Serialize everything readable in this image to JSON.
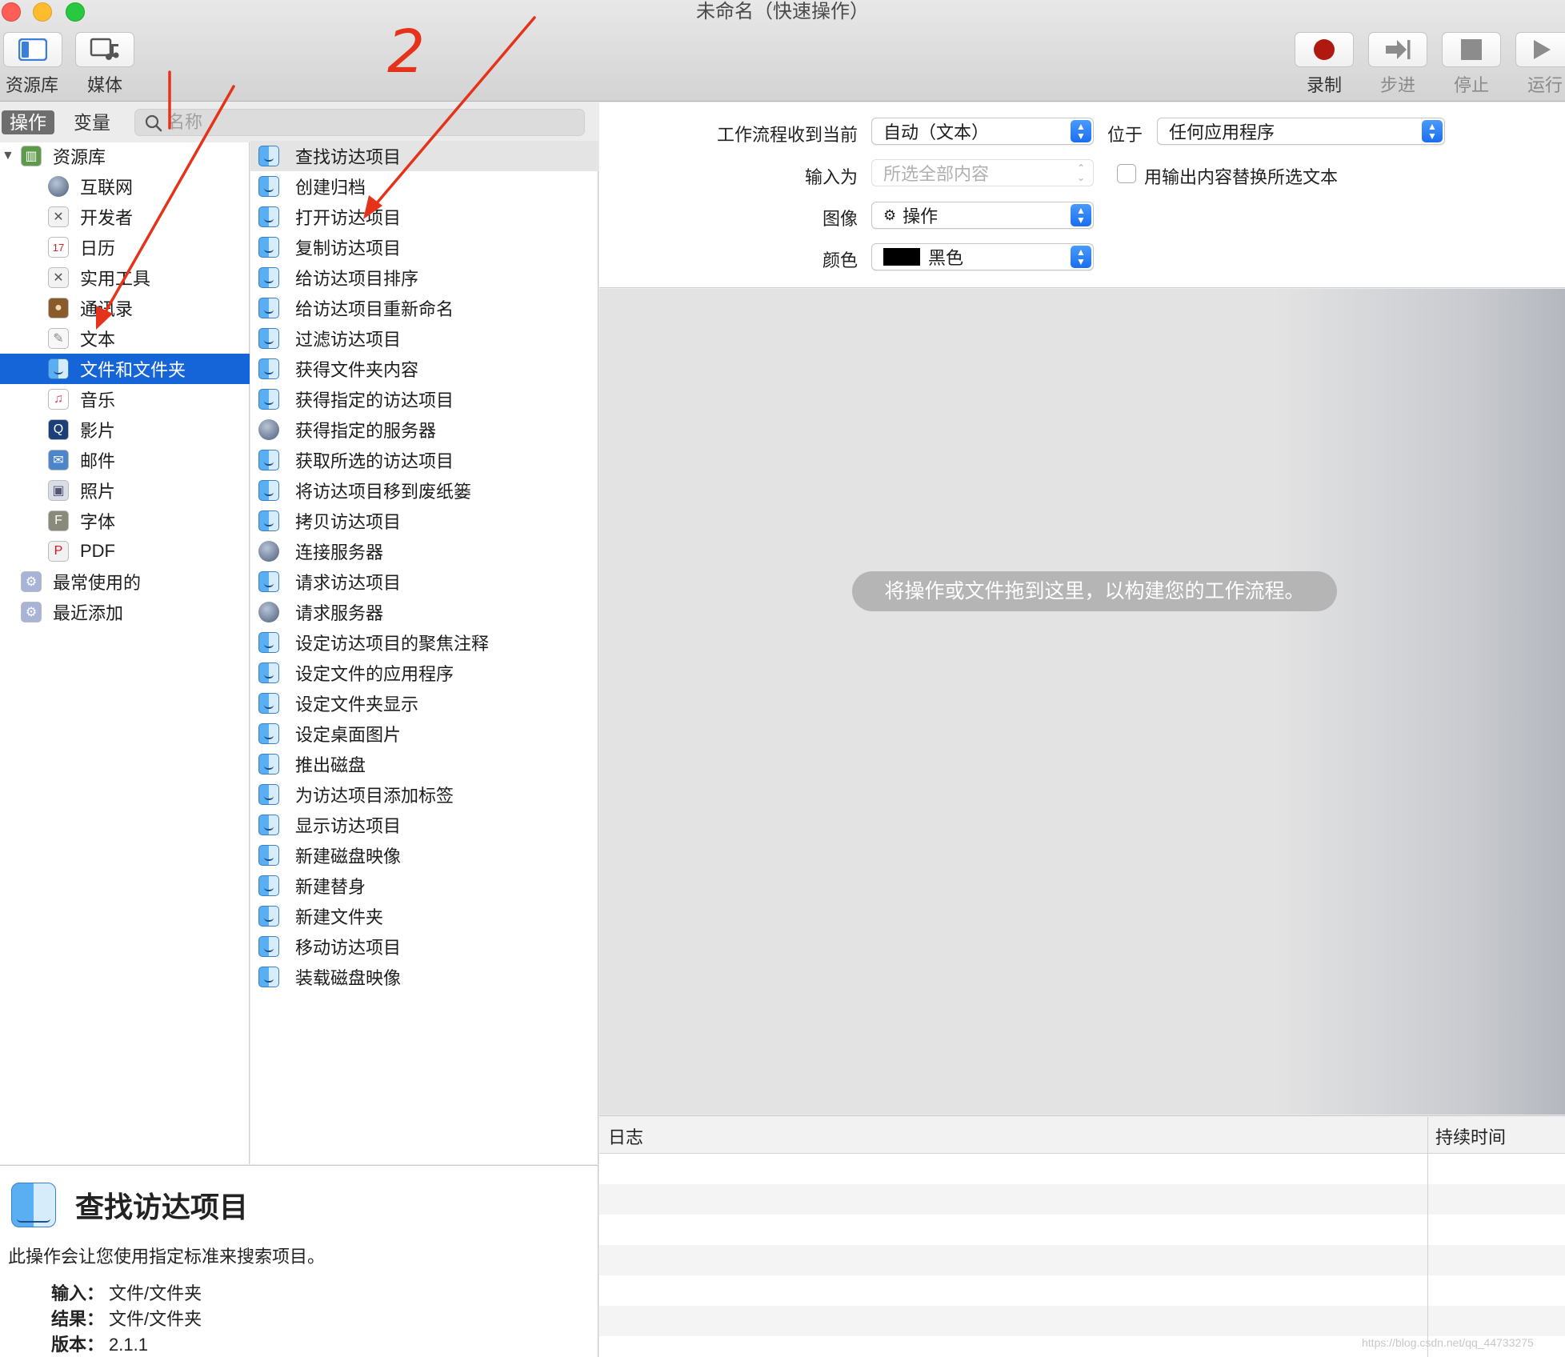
{
  "window": {
    "title": "未命名（快速操作）"
  },
  "toolbar": {
    "left": [
      {
        "label": "资源库",
        "icon": "library-icon"
      },
      {
        "label": "媒体",
        "icon": "media-icon"
      }
    ],
    "right": [
      {
        "label": "录制",
        "icon": "record-icon",
        "enabled": true
      },
      {
        "label": "步进",
        "icon": "step-icon",
        "enabled": false
      },
      {
        "label": "停止",
        "icon": "stop-icon",
        "enabled": false
      },
      {
        "label": "运行",
        "icon": "run-icon",
        "enabled": false
      }
    ]
  },
  "tabs": {
    "actions": "操作",
    "variables": "变量"
  },
  "search": {
    "placeholder": "名称",
    "value": ""
  },
  "library": {
    "root": "资源库",
    "items": [
      {
        "label": "互联网",
        "icon": "globe-icon"
      },
      {
        "label": "开发者",
        "icon": "tools-icon"
      },
      {
        "label": "日历",
        "icon": "calendar-icon"
      },
      {
        "label": "实用工具",
        "icon": "tools-icon"
      },
      {
        "label": "通讯录",
        "icon": "contacts-icon"
      },
      {
        "label": "文本",
        "icon": "text-icon"
      },
      {
        "label": "文件和文件夹",
        "icon": "finder-icon",
        "selected": true
      },
      {
        "label": "音乐",
        "icon": "music-icon"
      },
      {
        "label": "影片",
        "icon": "quicktime-icon"
      },
      {
        "label": "邮件",
        "icon": "mail-icon"
      },
      {
        "label": "照片",
        "icon": "photos-icon"
      },
      {
        "label": "字体",
        "icon": "font-icon"
      },
      {
        "label": "PDF",
        "icon": "pdf-icon"
      }
    ],
    "smart_groups": [
      {
        "label": "最常使用的",
        "icon": "smart-folder-icon"
      },
      {
        "label": "最近添加",
        "icon": "smart-folder-icon"
      }
    ]
  },
  "actions": [
    {
      "label": "查找访达项目",
      "icon": "finder-icon",
      "highlighted": true
    },
    {
      "label": "创建归档",
      "icon": "finder-icon"
    },
    {
      "label": "打开访达项目",
      "icon": "finder-icon"
    },
    {
      "label": "复制访达项目",
      "icon": "finder-icon"
    },
    {
      "label": "给访达项目排序",
      "icon": "finder-icon"
    },
    {
      "label": "给访达项目重新命名",
      "icon": "finder-icon"
    },
    {
      "label": "过滤访达项目",
      "icon": "finder-icon"
    },
    {
      "label": "获得文件夹内容",
      "icon": "finder-icon"
    },
    {
      "label": "获得指定的访达项目",
      "icon": "finder-icon"
    },
    {
      "label": "获得指定的服务器",
      "icon": "globe-icon"
    },
    {
      "label": "获取所选的访达项目",
      "icon": "finder-icon"
    },
    {
      "label": "将访达项目移到废纸篓",
      "icon": "finder-icon"
    },
    {
      "label": "拷贝访达项目",
      "icon": "finder-icon"
    },
    {
      "label": "连接服务器",
      "icon": "globe-icon"
    },
    {
      "label": "请求访达项目",
      "icon": "finder-icon"
    },
    {
      "label": "请求服务器",
      "icon": "globe-icon"
    },
    {
      "label": "设定访达项目的聚焦注释",
      "icon": "finder-icon"
    },
    {
      "label": "设定文件的应用程序",
      "icon": "finder-icon"
    },
    {
      "label": "设定文件夹显示",
      "icon": "finder-icon"
    },
    {
      "label": "设定桌面图片",
      "icon": "finder-icon"
    },
    {
      "label": "推出磁盘",
      "icon": "finder-icon"
    },
    {
      "label": "为访达项目添加标签",
      "icon": "finder-icon"
    },
    {
      "label": "显示访达项目",
      "icon": "finder-icon"
    },
    {
      "label": "新建磁盘映像",
      "icon": "finder-icon"
    },
    {
      "label": "新建替身",
      "icon": "finder-icon"
    },
    {
      "label": "新建文件夹",
      "icon": "finder-icon"
    },
    {
      "label": "移动访达项目",
      "icon": "finder-icon"
    },
    {
      "label": "装载磁盘映像",
      "icon": "finder-icon"
    }
  ],
  "description": {
    "title": "查找访达项目",
    "text": "此操作会让您使用指定标准来搜索项目。",
    "input_label": "输入：",
    "input_value": "文件/文件夹",
    "result_label": "结果：",
    "result_value": "文件/文件夹",
    "version_label": "版本：",
    "version_value": "2.1.1"
  },
  "workflow_options": {
    "receives_label": "工作流程收到当前",
    "receives_value": "自动（文本）",
    "in_label": "位于",
    "in_value": "任何应用程序",
    "input_is_label": "输入为",
    "input_is_value": "所选全部内容",
    "replace_label": "用输出内容替换所选文本",
    "replace_checked": false,
    "image_label": "图像",
    "image_value": "操作",
    "color_label": "颜色",
    "color_value": "黑色",
    "color_swatch": "#000000"
  },
  "workflow": {
    "hint": "将操作或文件拖到这里，以构建您的工作流程。"
  },
  "log": {
    "col_log": "日志",
    "col_duration": "持续时间"
  },
  "annotation": {
    "number": "2"
  },
  "watermark": "https://blog.csdn.net/qq_44733275"
}
